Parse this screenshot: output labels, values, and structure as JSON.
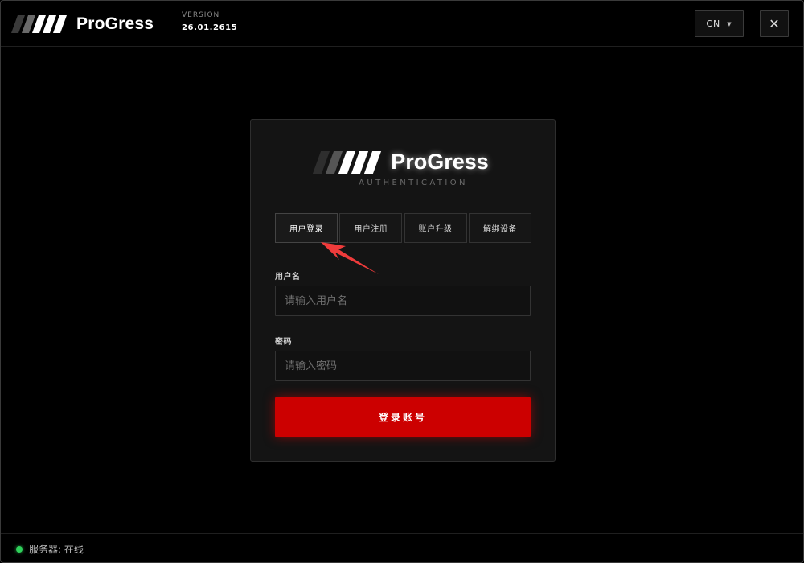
{
  "app": {
    "name": "ProGress",
    "version_label": "VERSION",
    "version": "26.01.2615"
  },
  "header": {
    "language": "CN",
    "close_symbol": "✕"
  },
  "card": {
    "title": "ProGress",
    "subtitle": "AUTHENTICATION",
    "tabs": [
      {
        "label": "用户登录",
        "active": true
      },
      {
        "label": "用户注册",
        "active": false
      },
      {
        "label": "账户升级",
        "active": false
      },
      {
        "label": "解绑设备",
        "active": false
      }
    ],
    "username": {
      "label": "用户名",
      "placeholder": "请输入用户名",
      "value": ""
    },
    "password": {
      "label": "密码",
      "placeholder": "请输入密码",
      "value": ""
    },
    "login_button": "登录账号"
  },
  "status": {
    "text": "服务器: 在线",
    "color": "#2fd05a"
  },
  "colors": {
    "accent": "#cc0000",
    "annotation_arrow": "#ef3b3b",
    "background": "#000000",
    "card": "#141414"
  }
}
